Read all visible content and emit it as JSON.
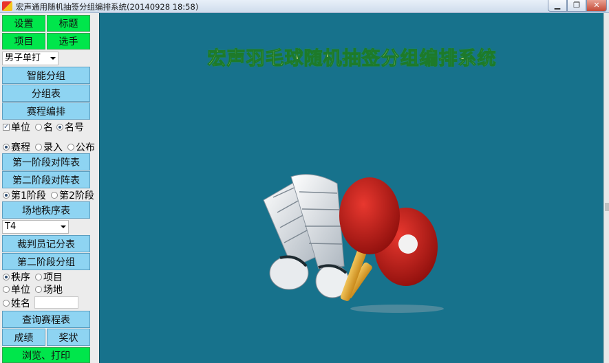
{
  "window": {
    "title": "宏声通用随机抽签分组编排系统(20140928 18:58)",
    "min": "▁",
    "max": "❐",
    "close": "✕"
  },
  "sidebar": {
    "settings": "设置",
    "title_btn": "标题",
    "events": "项目",
    "players": "选手",
    "event_select": "男子单打",
    "smart_group": "智能分组",
    "group_table": "分组表",
    "schedule": "赛程编排",
    "unit_label": "单位",
    "name_label": "名",
    "name_no_label": "名号",
    "mode_schedule": "赛程",
    "mode_entry": "录入",
    "mode_publish": "公布",
    "stage1_table": "第一阶段对阵表",
    "stage2_table": "第二阶段对阵表",
    "stage1": "第1阶段",
    "stage2": "第2阶段",
    "court_order": "场地秩序表",
    "court_select": "T4",
    "referee_sheet": "裁判员记分表",
    "stage2_group": "第二阶段分组",
    "by_order": "秩序",
    "by_event": "项目",
    "by_unit": "单位",
    "by_court": "场地",
    "by_name": "姓名",
    "query_schedule": "查询赛程表",
    "results": "成绩",
    "awards": "奖状",
    "preview_print": "浏览、打印"
  },
  "main": {
    "heading": "宏声羽毛球随机抽签分组编排系统"
  },
  "colors": {
    "panel_bg": "#17728c",
    "green_btn": "#00e64b",
    "blue_btn": "#8ed4f2",
    "heading": "#f6f3a1"
  }
}
